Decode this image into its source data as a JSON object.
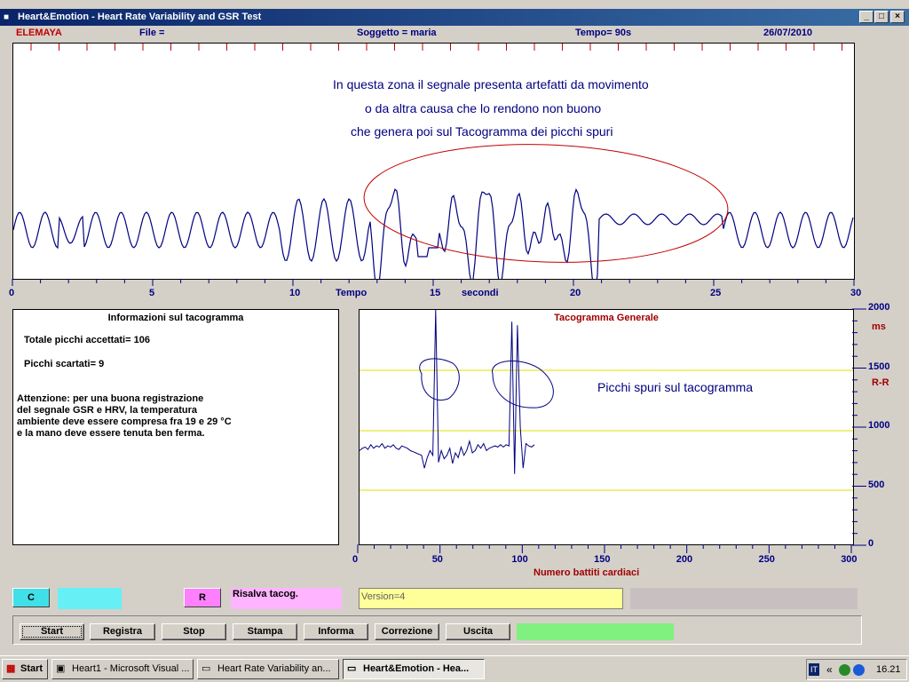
{
  "window": {
    "title": "Heart&Emotion -  Heart Rate Variability and GSR Test",
    "min_glyph": "_",
    "max_glyph": "□",
    "close_glyph": "×"
  },
  "info_bar": {
    "brand": "ELEMAYA",
    "file": "File  =",
    "subject": "Soggetto = maria",
    "time": "Tempo=  90s",
    "date": "26/07/2010"
  },
  "signal_panel": {
    "annotation_line1": "In questa zona il segnale presenta artefatti da movimento",
    "annotation_line2": "o da altra causa che lo rendono non buono",
    "annotation_line3": "che genera poi sul Tacogramma dei picchi spuri",
    "axis_ticks": [
      "0",
      "5",
      "10",
      "15",
      "20",
      "25",
      "30"
    ],
    "axis_label_tempo": "Tempo",
    "axis_label_secondi": "secondi"
  },
  "info_panel": {
    "title": "Informazioni sul tacogramma",
    "accepted": "Totale picchi accettati= 106",
    "rejected": "Picchi scartati= 9",
    "warning_1": "Attenzione: per una buona registrazione",
    "warning_2": "del segnale GSR e HRV, la temperatura",
    "warning_3": "ambiente deve essere compresa fra 19 e 29 °C",
    "warning_4": "e la mano deve essere tenuta ben ferma."
  },
  "tacogramma": {
    "title": "Tacogramma Generale",
    "annotation": "Picchi spuri sul tacogramma",
    "y_ticks": [
      "2000",
      "1500",
      "1000",
      "500",
      "0"
    ],
    "y_unit": "ms",
    "y_label": "R-R",
    "x_ticks": [
      "0",
      "50",
      "100",
      "150",
      "200",
      "250",
      "300"
    ],
    "x_label": "Numero battiti cardiaci",
    "colors": {
      "line": "#000080",
      "guides": "#e0e000",
      "title": "#a00000"
    }
  },
  "controls": {
    "c_label": "C",
    "r_label": "R",
    "risalva": "Risalva tacog.",
    "version": "Version=4"
  },
  "buttons": {
    "start": "Start",
    "registra": "Registra",
    "stop": "Stop",
    "stampa": "Stampa",
    "informa": "Informa",
    "correzione": "Correzione",
    "uscita": "Uscita"
  },
  "taskbar": {
    "start": "Start",
    "item1": "Heart1 - Microsoft Visual ...",
    "item2": "Heart Rate Variability an...",
    "item3": "Heart&Emotion - Hea...",
    "lang": "IT",
    "chevron": "«",
    "clock": "16.21"
  }
}
